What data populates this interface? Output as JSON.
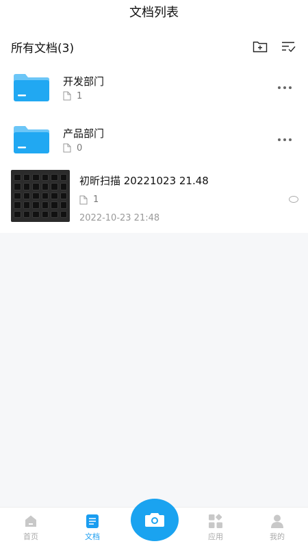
{
  "header": {
    "title": "文档列表"
  },
  "section": {
    "title": "所有文档(3)"
  },
  "folders": [
    {
      "name": "开发部门",
      "count": "1"
    },
    {
      "name": "产品部门",
      "count": "0"
    }
  ],
  "scan": {
    "name": "初昕扫描 20221023 21.48",
    "count": "1",
    "date": "2022-10-23 21:48"
  },
  "nav": {
    "home": "首页",
    "docs": "文档",
    "apps": "应用",
    "mine": "我的"
  },
  "colors": {
    "accent": "#1aa3f0",
    "folder": "#21a8f2"
  }
}
